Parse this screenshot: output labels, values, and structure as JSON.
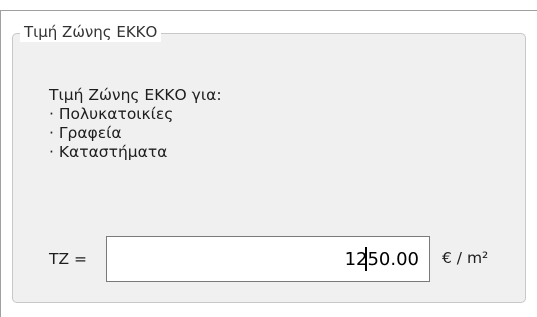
{
  "group": {
    "title": "Τιμή Ζώνης ΕΚΚΟ"
  },
  "description": {
    "heading": "Τιμή Ζώνης ΕΚΚΟ για:",
    "items": [
      "· Πολυκατοικίες",
      "· Γραφεία",
      "· Καταστήματα"
    ]
  },
  "tz": {
    "label": "TZ =",
    "value": "1250.00",
    "unit": "€ / m²"
  }
}
